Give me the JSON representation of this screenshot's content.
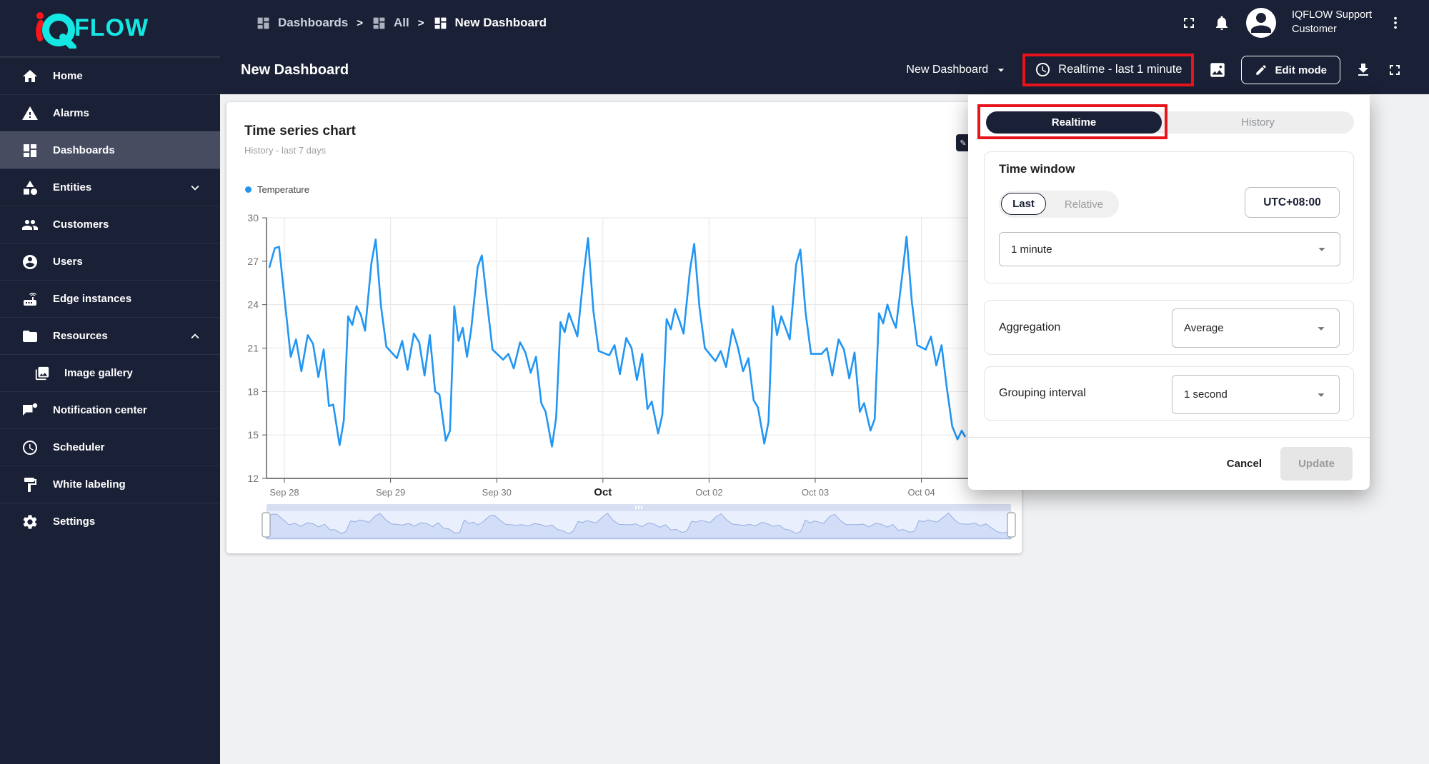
{
  "colors": {
    "navy": "#1a2035",
    "highlight_red": "#e8141c",
    "chart_line": "#2196f3",
    "logo_cyan": "#15e7e4",
    "logo_red": "#ff1418"
  },
  "logo": {
    "flow_text": "FLOW"
  },
  "breadcrumb": {
    "separator": ">",
    "items": [
      {
        "label": "Dashboards"
      },
      {
        "label": "All"
      },
      {
        "label": "New Dashboard"
      }
    ]
  },
  "topbar": {
    "user_name": "IQFLOW Support",
    "user_role": "Customer"
  },
  "titlebar": {
    "page_title": "New Dashboard",
    "dashboard_select_value": "New Dashboard",
    "timewindow_button_label": "Realtime - last 1 minute",
    "edit_mode_label": "Edit mode"
  },
  "sidebar": {
    "items": [
      {
        "label": "Home"
      },
      {
        "label": "Alarms"
      },
      {
        "label": "Dashboards"
      },
      {
        "label": "Entities"
      },
      {
        "label": "Customers"
      },
      {
        "label": "Users"
      },
      {
        "label": "Edge instances"
      },
      {
        "label": "Resources"
      },
      {
        "label": "Image gallery"
      },
      {
        "label": "Notification center"
      },
      {
        "label": "Scheduler"
      },
      {
        "label": "White labeling"
      },
      {
        "label": "Settings"
      }
    ]
  },
  "popup": {
    "tabs": {
      "realtime": "Realtime",
      "history": "History"
    },
    "time_window": {
      "heading": "Time window",
      "last_label": "Last",
      "relative_label": "Relative",
      "timezone": "UTC+08:00",
      "interval_value": "1 minute"
    },
    "aggregation": {
      "label": "Aggregation",
      "value": "Average"
    },
    "grouping": {
      "label": "Grouping interval",
      "value": "1 second"
    },
    "footer": {
      "cancel": "Cancel",
      "update": "Update"
    }
  },
  "widget": {
    "title": "Time series chart",
    "subtitle": "History - last 7 days",
    "legend": [
      {
        "name": "Temperature",
        "color": "#2196f3"
      }
    ]
  },
  "chart_data": {
    "type": "line",
    "title": "Time series chart",
    "xlabel": "",
    "ylabel": "",
    "yticks": [
      12,
      15,
      18,
      21,
      24,
      27,
      30
    ],
    "ylim": [
      12,
      30
    ],
    "xticklabels": [
      "Sep 28",
      "Sep 29",
      "Sep 30",
      "Oct",
      "Oct 02",
      "Oct 03",
      "Oct 04"
    ],
    "xtick_emphasis_index": 3,
    "grid": true,
    "legend_position": "top-left",
    "series": [
      {
        "name": "Temperature",
        "color": "#2196f3",
        "points": [
          [
            -0.14,
            26.6
          ],
          [
            -0.09,
            27.9
          ],
          [
            -0.05,
            28.0
          ],
          [
            0.06,
            20.4
          ],
          [
            0.11,
            21.6
          ],
          [
            0.16,
            19.4
          ],
          [
            0.22,
            21.9
          ],
          [
            0.27,
            21.3
          ],
          [
            0.32,
            19.0
          ],
          [
            0.37,
            20.9
          ],
          [
            0.42,
            17.0
          ],
          [
            0.46,
            17.1
          ],
          [
            0.52,
            14.3
          ],
          [
            0.56,
            16.0
          ],
          [
            0.6,
            23.2
          ],
          [
            0.64,
            22.6
          ],
          [
            0.68,
            23.9
          ],
          [
            0.72,
            23.3
          ],
          [
            0.76,
            22.2
          ],
          [
            0.82,
            26.9
          ],
          [
            0.86,
            28.5
          ],
          [
            0.91,
            23.9
          ],
          [
            0.96,
            21.1
          ],
          [
            1.06,
            20.3
          ],
          [
            1.11,
            21.5
          ],
          [
            1.16,
            19.5
          ],
          [
            1.22,
            22.0
          ],
          [
            1.27,
            21.4
          ],
          [
            1.32,
            19.1
          ],
          [
            1.37,
            21.9
          ],
          [
            1.42,
            18.0
          ],
          [
            1.46,
            17.8
          ],
          [
            1.52,
            14.6
          ],
          [
            1.56,
            15.3
          ],
          [
            1.6,
            23.9
          ],
          [
            1.64,
            21.5
          ],
          [
            1.68,
            22.4
          ],
          [
            1.72,
            20.4
          ],
          [
            1.76,
            22.3
          ],
          [
            1.82,
            26.6
          ],
          [
            1.86,
            27.4
          ],
          [
            1.91,
            24.1
          ],
          [
            1.96,
            20.9
          ],
          [
            2.06,
            20.2
          ],
          [
            2.11,
            20.6
          ],
          [
            2.16,
            19.6
          ],
          [
            2.22,
            21.4
          ],
          [
            2.27,
            20.7
          ],
          [
            2.32,
            19.3
          ],
          [
            2.37,
            20.4
          ],
          [
            2.42,
            17.2
          ],
          [
            2.46,
            16.6
          ],
          [
            2.52,
            14.2
          ],
          [
            2.56,
            16.2
          ],
          [
            2.6,
            22.8
          ],
          [
            2.64,
            22.1
          ],
          [
            2.68,
            23.4
          ],
          [
            2.72,
            22.6
          ],
          [
            2.76,
            21.8
          ],
          [
            2.82,
            26.2
          ],
          [
            2.86,
            28.6
          ],
          [
            2.91,
            23.6
          ],
          [
            2.96,
            20.8
          ],
          [
            3.06,
            20.5
          ],
          [
            3.11,
            21.2
          ],
          [
            3.16,
            19.2
          ],
          [
            3.22,
            21.7
          ],
          [
            3.27,
            21.0
          ],
          [
            3.32,
            18.8
          ],
          [
            3.37,
            20.6
          ],
          [
            3.42,
            16.8
          ],
          [
            3.46,
            17.3
          ],
          [
            3.52,
            15.1
          ],
          [
            3.56,
            16.4
          ],
          [
            3.6,
            23.0
          ],
          [
            3.64,
            22.3
          ],
          [
            3.68,
            23.7
          ],
          [
            3.72,
            22.9
          ],
          [
            3.76,
            22.0
          ],
          [
            3.82,
            26.4
          ],
          [
            3.86,
            28.2
          ],
          [
            3.91,
            23.8
          ],
          [
            3.96,
            21.0
          ],
          [
            4.06,
            20.1
          ],
          [
            4.11,
            20.8
          ],
          [
            4.16,
            19.7
          ],
          [
            4.22,
            22.3
          ],
          [
            4.27,
            21.1
          ],
          [
            4.32,
            19.4
          ],
          [
            4.37,
            20.3
          ],
          [
            4.42,
            17.4
          ],
          [
            4.46,
            16.9
          ],
          [
            4.52,
            14.4
          ],
          [
            4.56,
            15.9
          ],
          [
            4.6,
            23.9
          ],
          [
            4.64,
            21.9
          ],
          [
            4.68,
            23.2
          ],
          [
            4.72,
            22.4
          ],
          [
            4.76,
            21.6
          ],
          [
            4.82,
            26.8
          ],
          [
            4.86,
            27.8
          ],
          [
            4.91,
            23.4
          ],
          [
            4.96,
            20.6
          ],
          [
            5.06,
            20.6
          ],
          [
            5.11,
            21.0
          ],
          [
            5.16,
            19.1
          ],
          [
            5.22,
            21.6
          ],
          [
            5.27,
            20.9
          ],
          [
            5.32,
            18.9
          ],
          [
            5.37,
            20.7
          ],
          [
            5.42,
            16.6
          ],
          [
            5.46,
            17.2
          ],
          [
            5.52,
            15.3
          ],
          [
            5.56,
            16.1
          ],
          [
            5.6,
            23.4
          ],
          [
            5.64,
            22.7
          ],
          [
            5.68,
            24.0
          ],
          [
            5.72,
            23.1
          ],
          [
            5.76,
            22.4
          ],
          [
            5.82,
            26.1
          ],
          [
            5.86,
            28.7
          ],
          [
            5.91,
            24.2
          ],
          [
            5.96,
            21.2
          ],
          [
            6.04,
            20.9
          ],
          [
            6.09,
            21.8
          ],
          [
            6.14,
            19.8
          ],
          [
            6.19,
            21.2
          ],
          [
            6.24,
            18.2
          ],
          [
            6.29,
            15.6
          ],
          [
            6.34,
            14.7
          ],
          [
            6.38,
            15.3
          ],
          [
            6.41,
            14.9
          ]
        ]
      }
    ]
  }
}
